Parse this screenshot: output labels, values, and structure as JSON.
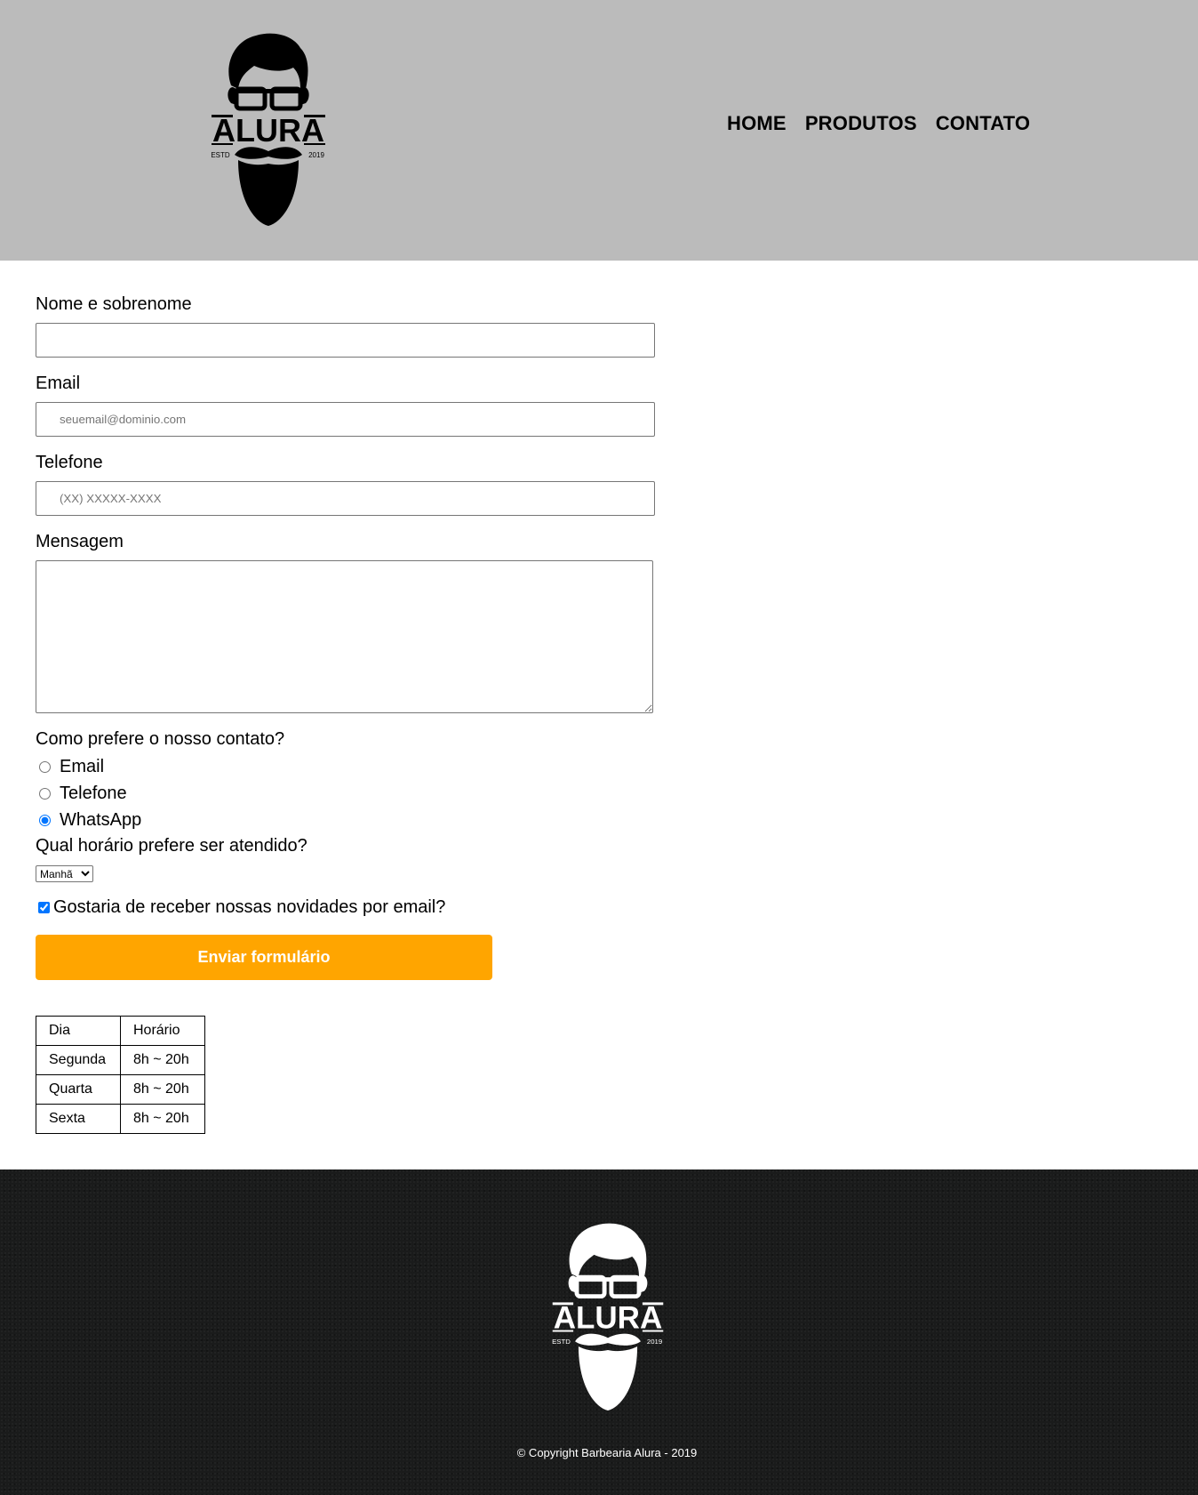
{
  "header": {
    "logo": {
      "brand": "ALURA",
      "left_text": "ESTD",
      "right_text": "2019"
    },
    "nav": [
      {
        "label": "HOME"
      },
      {
        "label": "PRODUTOS"
      },
      {
        "label": "CONTATO"
      }
    ]
  },
  "form": {
    "name_label": "Nome e sobrenome",
    "name_value": "",
    "email_label": "Email",
    "email_placeholder": "seuemail@dominio.com",
    "phone_label": "Telefone",
    "phone_placeholder": "(XX) XXXXX-XXXX",
    "message_label": "Mensagem",
    "contact_question": "Como prefere o nosso contato?",
    "contact_options": [
      {
        "label": "Email",
        "checked": false
      },
      {
        "label": "Telefone",
        "checked": false
      },
      {
        "label": "WhatsApp",
        "checked": true
      }
    ],
    "time_question": "Qual horário prefere ser atendido?",
    "time_selected": "Manhã",
    "newsletter_label": "Gostaria de receber nossas novidades por email?",
    "newsletter_checked": true,
    "submit_label": "Enviar formulário"
  },
  "hours_table": {
    "headers": [
      "Dia",
      "Horário"
    ],
    "rows": [
      [
        "Segunda",
        "8h ~ 20h"
      ],
      [
        "Quarta",
        "8h ~ 20h"
      ],
      [
        "Sexta",
        "8h ~ 20h"
      ]
    ]
  },
  "footer": {
    "logo": {
      "brand": "ALURA",
      "left_text": "ESTD",
      "right_text": "2019"
    },
    "copyright": "© Copyright Barbearia Alura - 2019"
  },
  "colors": {
    "header_bg": "#bbbbbb",
    "accent": "#ffa500",
    "footer_bg": "#1a1b1b"
  }
}
